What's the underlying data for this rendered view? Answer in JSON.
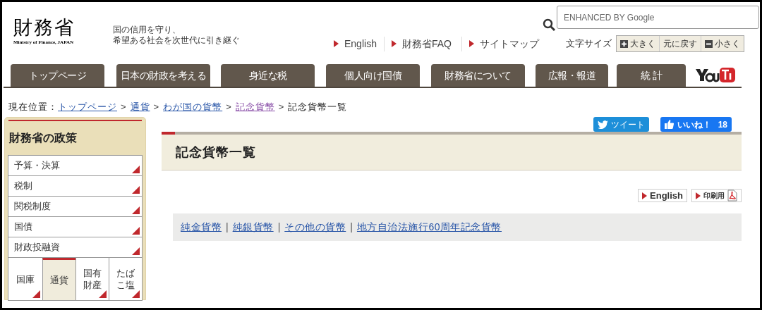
{
  "header": {
    "logo": "財務省",
    "logo_sub": "Ministry of Finance, JAPAN",
    "tagline": [
      "国の信用を守り、",
      "希望ある社会を次世代に引き継ぐ"
    ],
    "search": {
      "placeholder": "ENHANCED BY Google"
    },
    "links": [
      "English",
      "財務省FAQ",
      "サイトマップ"
    ],
    "font_size": {
      "label": "文字サイズ",
      "buttons": [
        {
          "kind": "plus",
          "label": "大きく"
        },
        {
          "kind": "plain",
          "label": "元に戻す"
        },
        {
          "kind": "minus",
          "label": "小さく"
        }
      ]
    }
  },
  "nav": [
    {
      "label": "トップページ",
      "selected": false
    },
    {
      "label": "日本の財政を考える",
      "selected": false
    },
    {
      "label": "身近な税",
      "selected": false
    },
    {
      "label": "個人向け国債",
      "selected": false
    },
    {
      "label": "財務省について",
      "selected": false
    },
    {
      "label": "広報・報道",
      "selected": false
    },
    {
      "label": "統 計",
      "selected": false
    }
  ],
  "breadcrumb": {
    "label": "現在位置：",
    "items": [
      {
        "label": "トップページ",
        "kind": "link"
      },
      {
        "separator": ">",
        "label": "通貨",
        "kind": "link"
      },
      {
        "separator": ">",
        "label": "わが国の貨幣",
        "kind": "link"
      },
      {
        "separator": ">",
        "label": "記念貨幣",
        "kind": "visited"
      },
      {
        "separator": ">",
        "label": "記念貨幣一覧",
        "kind": "current"
      }
    ]
  },
  "sidebar": {
    "title": "財務省の政策",
    "items": [
      "予算・決算",
      "税制",
      "関税制度",
      "国債",
      "財政投融資"
    ],
    "tiles": [
      {
        "label": "国庫",
        "selected": false
      },
      {
        "label": "通貨",
        "selected": true
      },
      {
        "label": "国有財産",
        "selected": false
      },
      {
        "label": "たばこ塩",
        "selected": false
      }
    ]
  },
  "share": {
    "tweet": "ツイート",
    "like": "いいね！",
    "like_count": "18"
  },
  "page_title": "記念貨幣一覧",
  "tools": [
    {
      "kind": "english",
      "label": "English"
    },
    {
      "kind": "print",
      "label": "印刷用"
    }
  ],
  "coin_links": [
    {
      "label": "純金貨幣",
      "separator": "|"
    },
    {
      "label": "純銀貨幣",
      "separator": "|"
    },
    {
      "label": "その他の貨幣",
      "separator": "|"
    },
    {
      "label": "地方自治法施行60周年記念貨幣"
    }
  ]
}
